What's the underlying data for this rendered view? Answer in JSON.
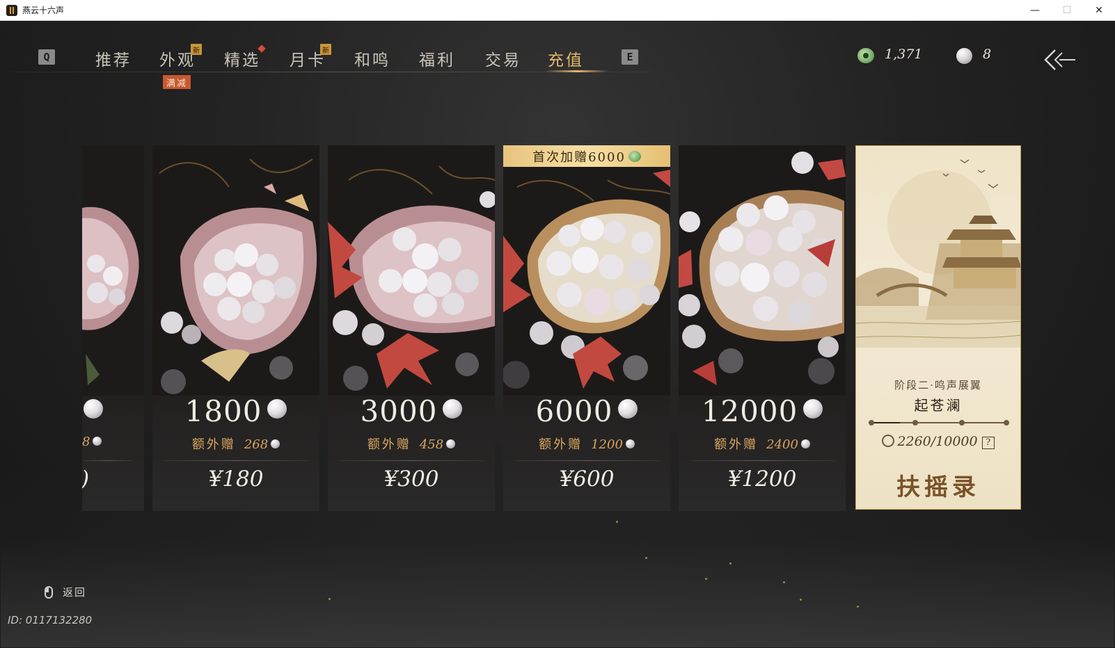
{
  "window": {
    "title": "燕云十六声",
    "minimize": "—",
    "maximize": "☐",
    "close": "✕"
  },
  "nav": {
    "key_left": "Q",
    "key_right": "E",
    "tabs": [
      {
        "label": "推荐"
      },
      {
        "label": "外观",
        "badge": "新",
        "tag": "满减"
      },
      {
        "label": "精选",
        "dot": true
      },
      {
        "label": "月卡",
        "badge": "新"
      },
      {
        "label": "和鸣"
      },
      {
        "label": "福利"
      },
      {
        "label": "交易"
      },
      {
        "label": "充值",
        "active": true
      }
    ]
  },
  "currency": {
    "jade_value": "1,371",
    "pearl_value": "8"
  },
  "cards": [
    {
      "amount": "1800",
      "bonus_label": "额外赠",
      "bonus_value": "268",
      "price": "¥180"
    },
    {
      "amount": "3000",
      "bonus_label": "额外赠",
      "bonus_value": "458",
      "price": "¥300"
    },
    {
      "amount": "6000",
      "bonus_label": "额外赠",
      "bonus_value": "1200",
      "price": "¥600",
      "first_bonus": "首次加赠6000"
    },
    {
      "amount": "12000",
      "bonus_label": "额外赠",
      "bonus_value": "2400",
      "price": "¥1200"
    }
  ],
  "partial_card": {
    "bonus_value": "8",
    "price": ")"
  },
  "scroll": {
    "stage": "阶段二·鸣声展翼",
    "stage_name": "起苍澜",
    "points": "2260/10000",
    "progress": 0.226,
    "help": "?",
    "book": "扶摇录"
  },
  "footer": {
    "back_label": "返回",
    "player_id": "ID: 0117132280"
  },
  "colors": {
    "accent_gold": "#e4b86a",
    "bonus_orange": "#d9a65f",
    "sale_tag": "#c7592f"
  }
}
